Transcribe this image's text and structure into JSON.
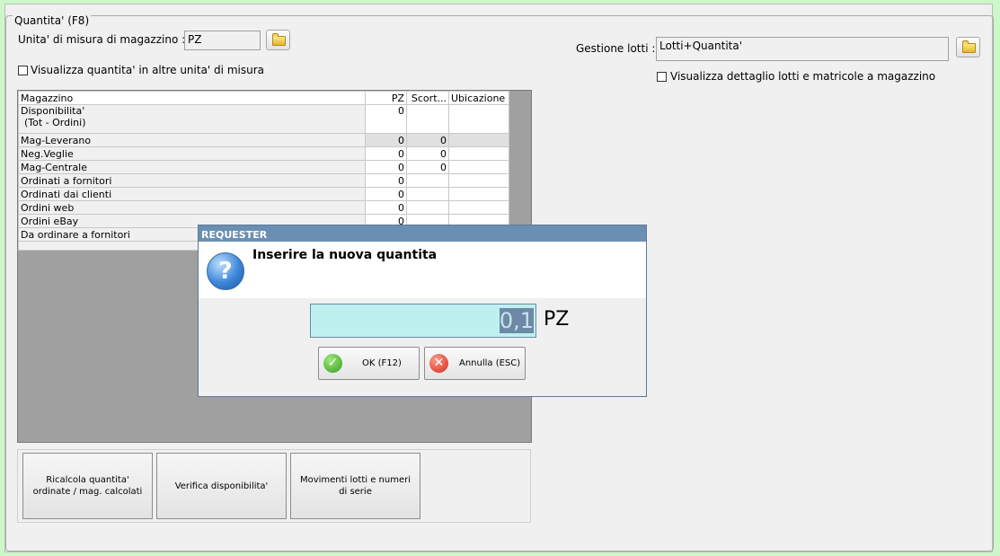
{
  "colors": {
    "window_bg": "#ccf7c8",
    "panel_bg": "#f0f0f0",
    "dialog_title_bg": "#6b8fb2",
    "input_bg": "#bff0f0"
  },
  "group": {
    "legend": "Quantita' (F8)"
  },
  "uom": {
    "label": "Unita' di misura di magazzino :",
    "value": "PZ"
  },
  "lots": {
    "label": "Gestione lotti :",
    "value": "Lotti+Quantita'"
  },
  "options": {
    "show_other_units": "Visualizza quantita' in altre unita' di misura",
    "show_lot_details": "Visualizza dettaglio lotti e matricole a magazzino"
  },
  "grid": {
    "headers": [
      "Magazzino",
      "PZ",
      "Scort...",
      "Ubicazione"
    ],
    "rows": [
      {
        "name": "Disponibilita'",
        "name2": "(Tot - Ordini)",
        "pz": "0",
        "scorta": "",
        "loc": ""
      },
      {
        "name": "Mag-Leverano",
        "pz": "0",
        "scorta": "0",
        "loc": ""
      },
      {
        "name": "Neg.Veglie",
        "pz": "0",
        "scorta": "0",
        "loc": ""
      },
      {
        "name": "Mag-Centrale",
        "pz": "0",
        "scorta": "0",
        "loc": ""
      },
      {
        "name": "Ordinati a fornitori",
        "pz": "0",
        "scorta": "",
        "loc": ""
      },
      {
        "name": "Ordinati dai clienti",
        "pz": "0",
        "scorta": "",
        "loc": ""
      },
      {
        "name": "Ordini web",
        "pz": "0",
        "scorta": "",
        "loc": ""
      },
      {
        "name": "Ordini eBay",
        "pz": "0",
        "scorta": "",
        "loc": ""
      },
      {
        "name": "Da ordinare a fornitori",
        "pz": "",
        "scorta": "",
        "loc": ""
      }
    ]
  },
  "buttons": {
    "recalc": "Ricalcola quantita' ordinate / mag. calcolati",
    "verify": "Verifica disponibilita'",
    "movements": "Movimenti lotti e numeri di serie"
  },
  "dialog": {
    "title": "REQUESTER",
    "prompt": "Inserire la nuova quantita",
    "value": "0,1",
    "unit": "PZ",
    "ok": "OK (F12)",
    "cancel": "Annulla (ESC)",
    "icon": "question-icon"
  }
}
